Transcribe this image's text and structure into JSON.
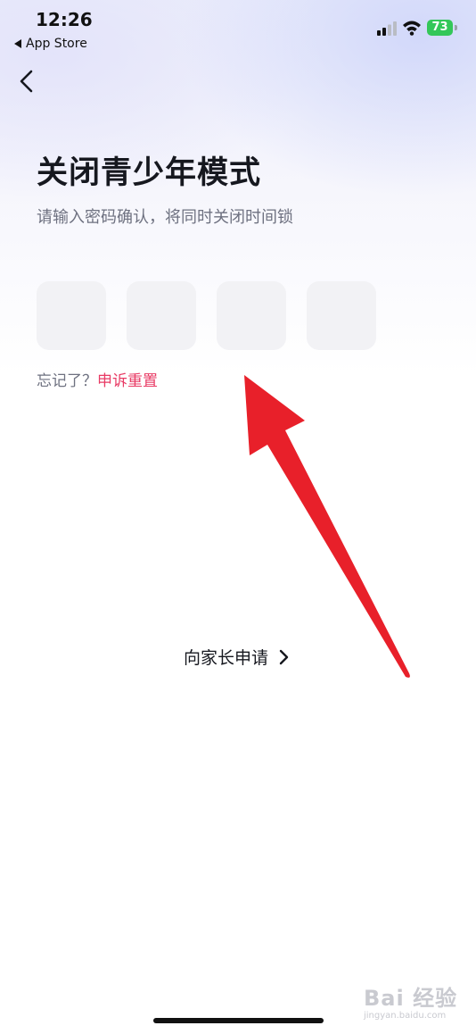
{
  "status_bar": {
    "time": "12:26",
    "back_app": "App Store",
    "battery": "73"
  },
  "page": {
    "title": "关闭青少年模式",
    "subtitle": "请输入密码确认，将同时关闭时间锁",
    "pin_length": 4,
    "forgot_prefix": "忘记了？",
    "forgot_link": "申诉重置",
    "parent_apply": "向家长申请"
  },
  "watermark": {
    "text": "Bai 经验",
    "sub": "jingyan.baidu.com"
  },
  "colors": {
    "accent": "#e83a64",
    "battery": "#34c759",
    "annotation_arrow": "#e8202a"
  }
}
